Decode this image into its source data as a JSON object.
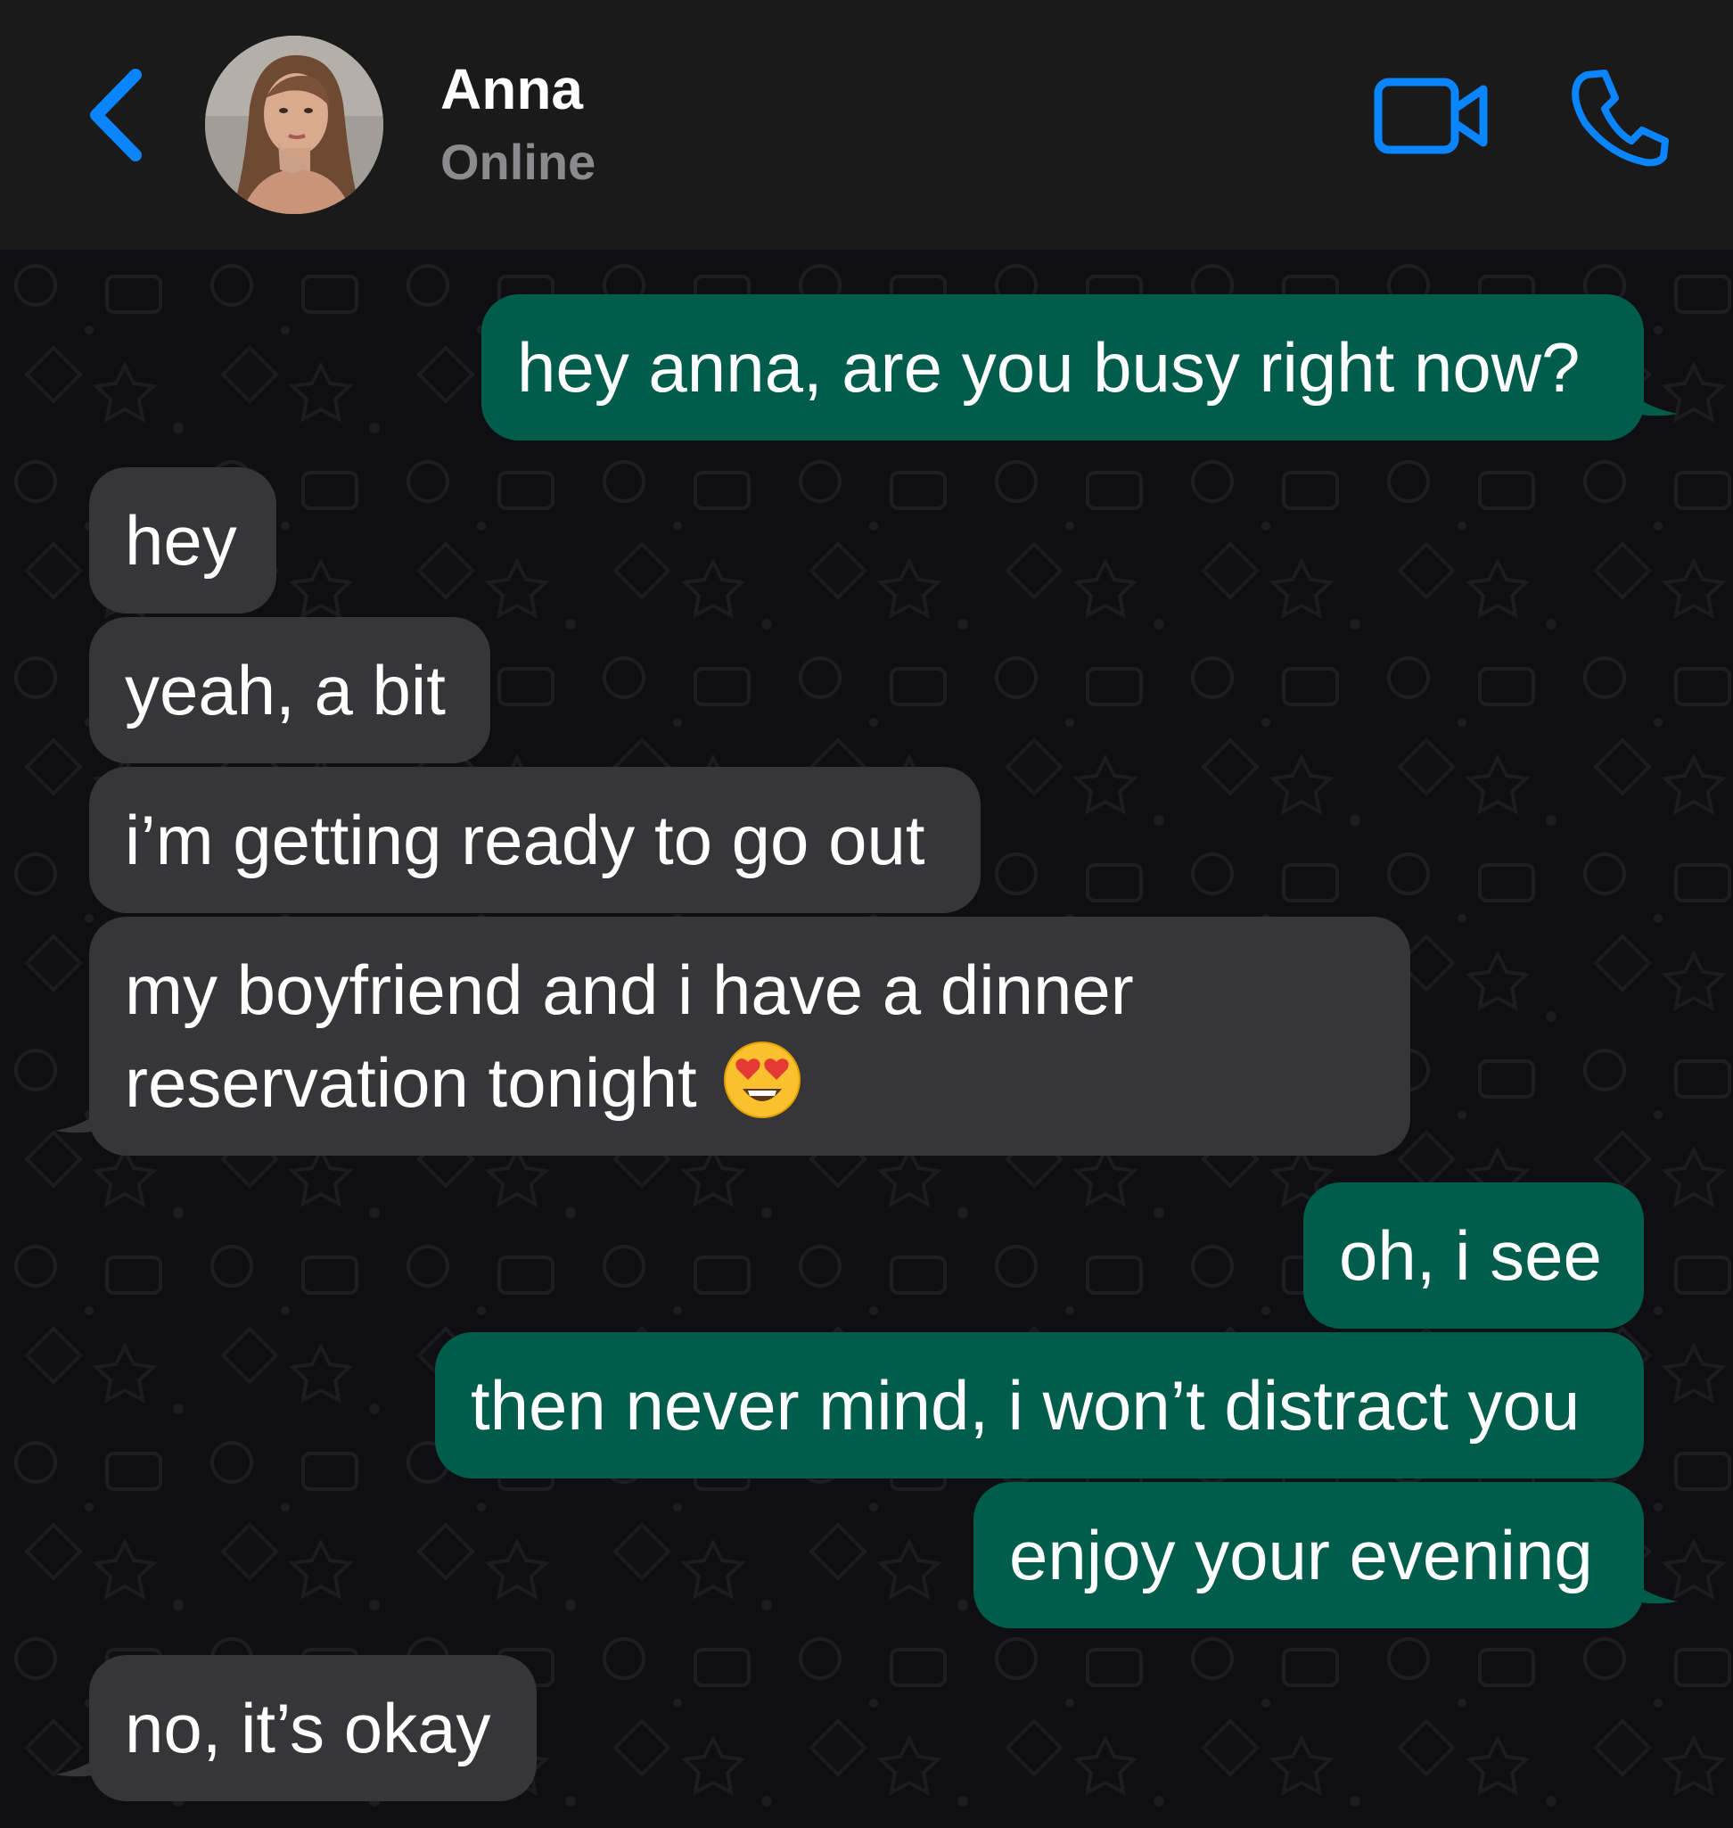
{
  "header": {
    "contact_name": "Anna",
    "status": "Online",
    "accent_color": "#0a84ff",
    "icons": [
      "chevron-left-icon",
      "video-camera-icon",
      "phone-icon"
    ]
  },
  "colors": {
    "outgoing_bubble": "#005c4b",
    "incoming_bubble": "#363638",
    "header_background": "#1a1a1b",
    "chat_background": "#0f0f12"
  },
  "messages": [
    {
      "direction": "outgoing",
      "text": "hey anna, are you busy right now?"
    },
    {
      "direction": "incoming",
      "text": "hey"
    },
    {
      "direction": "incoming",
      "text": "yeah, a bit"
    },
    {
      "direction": "incoming",
      "text": "i’m getting ready to go out"
    },
    {
      "direction": "incoming",
      "text_line1": "my boyfriend and i have a dinner",
      "text_line2": "reservation tonight",
      "emoji": "smiling-face-with-heart-eyes"
    },
    {
      "direction": "outgoing",
      "text": "oh, i see"
    },
    {
      "direction": "outgoing",
      "text": "then never mind, i won’t distract you"
    },
    {
      "direction": "outgoing",
      "text": "enjoy your evening"
    },
    {
      "direction": "incoming",
      "text": "no, it’s okay"
    }
  ]
}
